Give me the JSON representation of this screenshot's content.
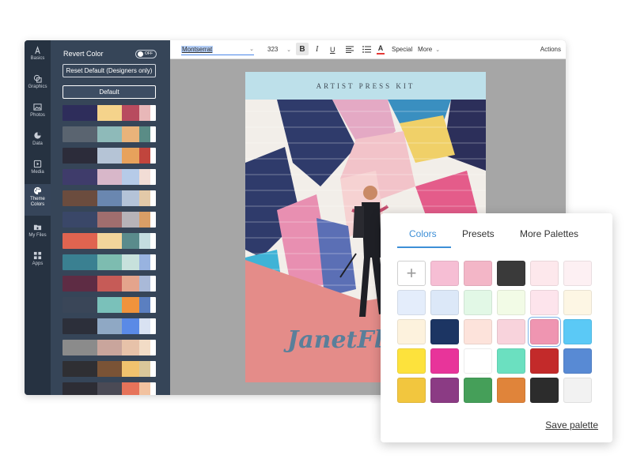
{
  "sidebar": {
    "items": [
      {
        "label": "Basics",
        "icon": "basics-icon"
      },
      {
        "label": "Graphics",
        "icon": "graphics-icon"
      },
      {
        "label": "Photos",
        "icon": "photos-icon"
      },
      {
        "label": "Data",
        "icon": "data-icon"
      },
      {
        "label": "Media",
        "icon": "media-icon"
      },
      {
        "label": "Theme Colors",
        "icon": "palette-icon",
        "active": true
      },
      {
        "label": "My Files",
        "icon": "files-icon"
      },
      {
        "label": "Apps",
        "icon": "apps-icon"
      }
    ]
  },
  "theme_panel": {
    "revert_label": "Revert Color",
    "toggle_state": "OFF",
    "reset_button": "Reset Default (Designers only)",
    "default_button": "Default",
    "palettes": [
      [
        "#2e2d5b",
        "#f5d38b",
        "#b84b5f",
        "#e8b7b8",
        "#ffffff"
      ],
      [
        "#5a6470",
        "#8ebab9",
        "#e9b37a",
        "#5a8c86",
        "#ffffff"
      ],
      [
        "#2c2c3a",
        "#b5c4d6",
        "#e7a25c",
        "#c1453d",
        "#ffffff"
      ],
      [
        "#3f3c6b",
        "#d8b7c9",
        "#b6cbe8",
        "#f2ddd6",
        "#ffffff"
      ],
      [
        "#6b4c3e",
        "#6a87b0",
        "#b4c3d8",
        "#e3c9a8",
        "#ffffff"
      ],
      [
        "#3a4768",
        "#a06e6e",
        "#b7b3b8",
        "#d99e66",
        "#ffffff"
      ],
      [
        "#e06450",
        "#f2d59b",
        "#5a8b8c",
        "#c4dde0",
        "#ffffff"
      ],
      [
        "#3a8091",
        "#7dbcb0",
        "#c7e1dc",
        "#98b3e0",
        "#ffffff"
      ],
      [
        "#5e2c44",
        "#c65b57",
        "#e4a48c",
        "#a9b9d8",
        "#ffffff"
      ],
      [
        "#3a4658",
        "#7ac1ba",
        "#f0933c",
        "#5b7fc0",
        "#ffffff"
      ],
      [
        "#2c2f3a",
        "#8fa8c4",
        "#5a8ae6",
        "#d9e2f2",
        "#ffffff"
      ],
      [
        "#8b8b8b",
        "#c9a59c",
        "#e7c2a9",
        "#f2dcc6",
        "#ffffff"
      ],
      [
        "#2f2f33",
        "#7a5336",
        "#f0c26e",
        "#d9c79a",
        "#ffffff"
      ],
      [
        "#2d2d35",
        "#4a4a55",
        "#e6735a",
        "#f2c2a0",
        "#ffffff"
      ]
    ]
  },
  "toolbar": {
    "font": "Montserrat",
    "size": "323",
    "bold": "B",
    "italic": "I",
    "underline": "U",
    "text_color_glyph": "A",
    "special": "Special",
    "more": "More",
    "actions": "Actions"
  },
  "document": {
    "header": "ARTIST PRESS KIT",
    "name": "JanetFle"
  },
  "picker": {
    "tabs": [
      "Colors",
      "Presets",
      "More Palettes"
    ],
    "active_tab": "Colors",
    "add_glyph": "+",
    "swatches": [
      "#f6bed4",
      "#f3b6c7",
      "#3a3a3a",
      "#fde8ec",
      "#fdf0f3",
      "#e4edfb",
      "#dce8f8",
      "#e2f8e6",
      "#f2fbe6",
      "#fde4ec",
      "#fdf6e4",
      "#fdf2dd",
      "#1c3563",
      "#fde3db",
      "#f8d3dc",
      "#ef95b1",
      "#5bc9f6",
      "#fde23c",
      "#e8349a",
      "#ffffff",
      "#6be0c0",
      "#c32a2a",
      "#588ad4",
      "#f2c63e",
      "#8b3b84",
      "#459f59",
      "#e0843a",
      "#2c2c2c",
      "#f2f2f2"
    ],
    "selected_index": 15,
    "save_label": "Save palette"
  }
}
